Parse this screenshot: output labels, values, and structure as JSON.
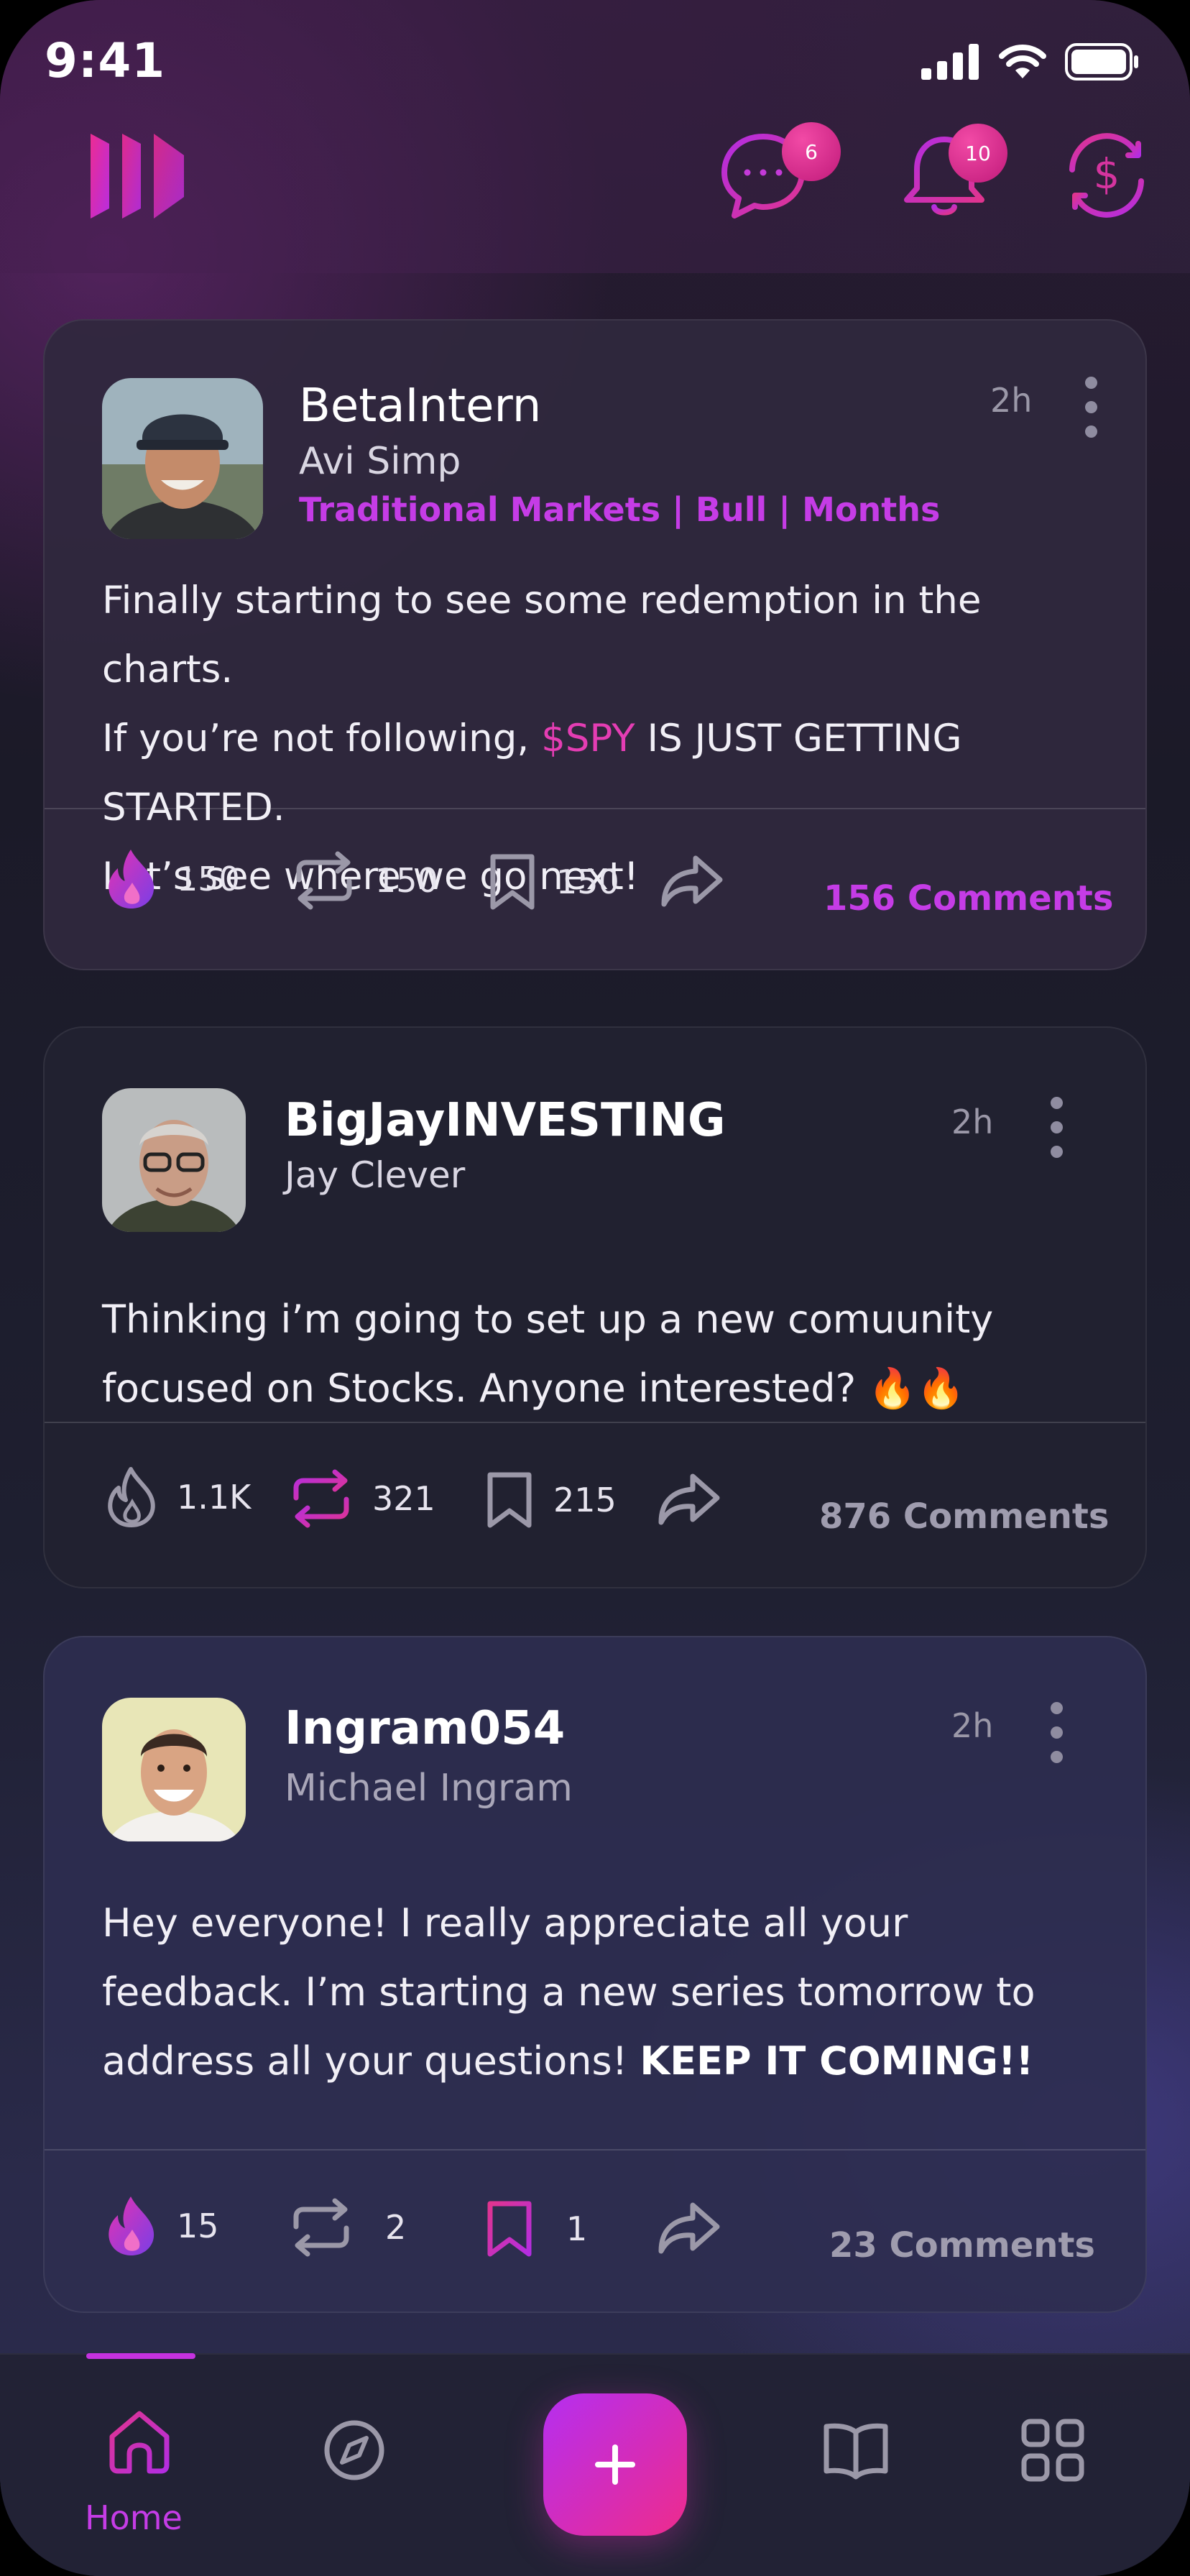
{
  "status_bar": {
    "time": "9:41"
  },
  "header": {
    "messages_badge": "6",
    "notifications_badge": "10"
  },
  "posts": [
    {
      "username": "BetaIntern",
      "display_name": "Avi Simp",
      "tags": "Traditional Markets | Bull | Months",
      "time": "2h",
      "body_lines": [
        "Finally starting to see some redemption in the charts.",
        "IS JUST GETTING STARTED.",
        "Let’s see where we go next!"
      ],
      "body_line2_prefix": "If you’re not following, ",
      "cashtag": "$SPY",
      "likes": "150",
      "reposts": "150",
      "saves": "150",
      "comments": "156 Comments"
    },
    {
      "username": "BigJayINVESTING",
      "display_name": "Jay Clever",
      "time": "2h",
      "body_lines": [
        "Thinking i’m going to set up a new comuunity",
        "focused on Stocks. Anyone interested? 🔥🔥"
      ],
      "likes": "1.1K",
      "reposts": "321",
      "saves": "215",
      "comments": "876 Comments"
    },
    {
      "username": "Ingram054",
      "display_name": "Michael Ingram",
      "time": "2h",
      "body_lines": [
        "Hey everyone! I really appreciate all your",
        "feedback. I’m starting a new series tomorrow to",
        "address all your questions! "
      ],
      "body_emphasis": "KEEP IT COMING!!",
      "likes": "15",
      "reposts": "2",
      "saves": "1",
      "comments": "23 Comments"
    }
  ],
  "nav": {
    "home_label": "Home"
  },
  "colors": {
    "accent": "#c53ce6",
    "pink": "#e43db3",
    "background": "#1e1f30"
  }
}
